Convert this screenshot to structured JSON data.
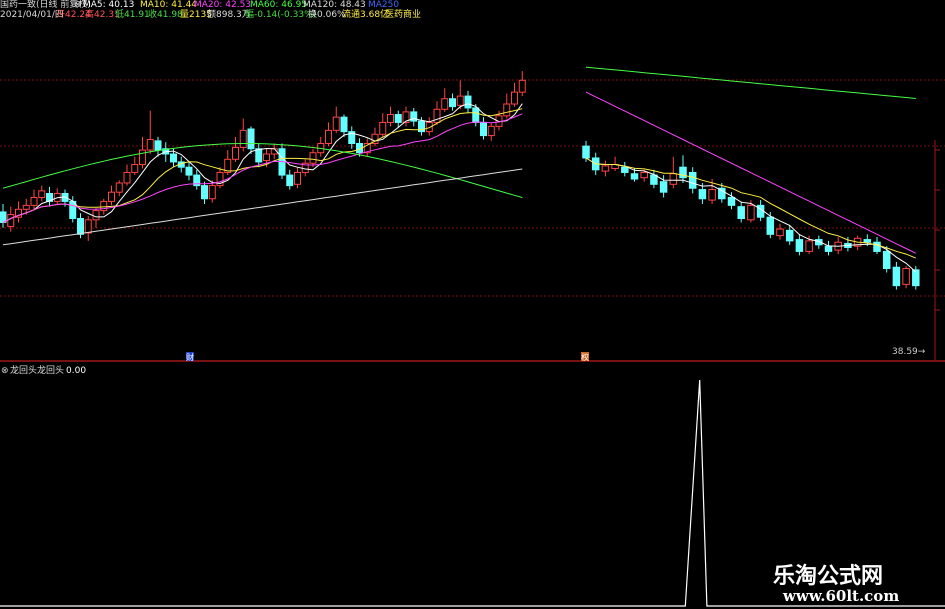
{
  "header": {
    "row1": [
      {
        "text": "国药一致(日线 前复权)",
        "color": "#d8d8d8",
        "left": 0
      },
      {
        "text": "⊗",
        "color": "#d8d8d8",
        "left": 74
      },
      {
        "text": "MA5: 40.13",
        "color": "#ffffff",
        "left": 83
      },
      {
        "text": "MA10: 41.44",
        "color": "#ffee44",
        "left": 140
      },
      {
        "text": "MA20: 42.53",
        "color": "#ff44ff",
        "left": 194
      },
      {
        "text": "MA60: 46.95",
        "color": "#44ff44",
        "left": 250
      },
      {
        "text": "MA120: 48.43",
        "color": "#dddddd",
        "left": 303
      },
      {
        "text": "MA250",
        "color": "#4466ff",
        "left": 368
      }
    ],
    "row2": [
      {
        "text": "2021/04/01/四",
        "color": "#d8d8d8",
        "left": 0
      },
      {
        "text": "开42.24",
        "color": "#ff5555",
        "left": 56
      },
      {
        "text": "高42.31",
        "color": "#ff5555",
        "left": 85
      },
      {
        "text": "低41.91",
        "color": "#44dd44",
        "left": 115
      },
      {
        "text": "收41.98",
        "color": "#44dd44",
        "left": 148
      },
      {
        "text": "量2135",
        "color": "#ffee44",
        "left": 180
      },
      {
        "text": "额898.3万",
        "color": "#dddddd",
        "left": 207
      },
      {
        "text": "幅-0.14(-0.33%)",
        "color": "#44dd44",
        "left": 245
      },
      {
        "text": "换0.06%",
        "color": "#dddddd",
        "left": 308
      },
      {
        "text": "流通3.68亿",
        "color": "#ffee44",
        "left": 342
      },
      {
        "text": "医药商业",
        "color": "#ffee44",
        "left": 385
      }
    ]
  },
  "price_axis": {
    "last_price_label": "38.59→"
  },
  "markers": [
    {
      "text": "财",
      "x": 190
    },
    {
      "text": "权",
      "x": 585
    }
  ],
  "indicator": {
    "title": "龙回头",
    "label": "龙回头",
    "value": "0.00"
  },
  "watermark": {
    "line1": "乐淘公式网",
    "line2": "www.60lt.com"
  },
  "colors": {
    "up": "#ff4444",
    "down": "#66ffff",
    "grid": "#7a1010",
    "ma5": "#ffffff",
    "ma10": "#ffee44",
    "ma20": "#ff44ff",
    "ma60": "#44ff44",
    "ma120": "#dddddd"
  },
  "chart_data": [
    {
      "type": "candlestick",
      "columns": [
        "open",
        "close",
        "high",
        "low"
      ],
      "segment_a": [
        [
          44.8,
          44.0,
          45.4,
          43.6
        ],
        [
          43.7,
          44.6,
          45.2,
          43.3
        ],
        [
          44.4,
          45.0,
          45.6,
          44.0
        ],
        [
          45.0,
          45.3,
          45.8,
          44.6
        ],
        [
          45.3,
          45.9,
          46.5,
          45.0
        ],
        [
          45.9,
          46.4,
          46.8,
          45.6
        ],
        [
          46.2,
          45.6,
          46.7,
          45.2
        ],
        [
          45.6,
          46.2,
          46.6,
          45.3
        ],
        [
          46.2,
          45.6,
          46.5,
          45.2
        ],
        [
          45.6,
          44.3,
          46.0,
          44.0
        ],
        [
          44.3,
          43.1,
          44.7,
          42.8
        ],
        [
          43.2,
          44.2,
          44.5,
          42.6
        ],
        [
          44.2,
          44.9,
          45.1,
          43.6
        ],
        [
          44.9,
          45.6,
          45.8,
          44.6
        ],
        [
          45.6,
          46.3,
          46.8,
          45.3
        ],
        [
          46.3,
          47.0,
          47.2,
          46.0
        ],
        [
          47.0,
          47.8,
          48.4,
          46.8
        ],
        [
          47.8,
          48.4,
          49.0,
          47.6
        ],
        [
          48.4,
          49.5,
          50.5,
          48.1
        ],
        [
          49.5,
          50.3,
          52.5,
          49.2
        ],
        [
          50.2,
          49.5,
          50.5,
          49.0
        ],
        [
          49.6,
          49.2,
          50.1,
          48.6
        ],
        [
          49.2,
          48.6,
          49.6,
          48.2
        ],
        [
          48.6,
          48.2,
          49.0,
          47.8
        ],
        [
          48.2,
          47.6,
          48.6,
          47.2
        ],
        [
          47.6,
          46.8,
          48.0,
          46.5
        ],
        [
          46.8,
          45.8,
          47.1,
          45.4
        ],
        [
          45.8,
          46.8,
          47.2,
          45.5
        ],
        [
          46.8,
          47.8,
          48.2,
          46.6
        ],
        [
          47.8,
          48.8,
          49.5,
          47.6
        ],
        [
          48.8,
          49.7,
          50.5,
          48.6
        ],
        [
          49.7,
          51.0,
          51.9,
          49.4
        ],
        [
          51.1,
          49.6,
          51.3,
          49.2
        ],
        [
          49.6,
          48.6,
          50.0,
          48.2
        ],
        [
          48.7,
          49.2,
          49.6,
          48.2
        ],
        [
          49.2,
          49.6,
          50.0,
          48.8
        ],
        [
          49.6,
          47.6,
          50.0,
          47.3
        ],
        [
          47.6,
          46.8,
          48.0,
          46.5
        ],
        [
          46.9,
          47.8,
          48.2,
          46.6
        ],
        [
          47.8,
          48.5,
          48.8,
          47.5
        ],
        [
          48.5,
          49.3,
          49.6,
          48.2
        ],
        [
          49.3,
          50.0,
          50.5,
          49.0
        ],
        [
          50.0,
          51.0,
          51.6,
          49.8
        ],
        [
          51.0,
          52.0,
          52.8,
          50.8
        ],
        [
          52.0,
          50.9,
          52.2,
          50.5
        ],
        [
          50.9,
          50.0,
          51.3,
          49.6
        ],
        [
          50.0,
          49.3,
          50.4,
          49.0
        ],
        [
          49.3,
          50.0,
          50.4,
          49.0
        ],
        [
          50.0,
          50.7,
          51.2,
          49.8
        ],
        [
          50.7,
          51.6,
          52.3,
          50.5
        ],
        [
          51.6,
          52.2,
          52.8,
          51.3
        ],
        [
          52.2,
          51.6,
          52.5,
          51.2
        ],
        [
          51.6,
          52.4,
          52.8,
          51.3
        ],
        [
          52.4,
          51.7,
          52.7,
          51.3
        ],
        [
          51.7,
          50.9,
          52.0,
          50.6
        ],
        [
          50.9,
          51.6,
          52.0,
          50.6
        ],
        [
          51.6,
          52.6,
          53.2,
          51.4
        ],
        [
          52.6,
          53.4,
          54.2,
          52.4
        ],
        [
          53.4,
          52.8,
          53.8,
          52.5
        ],
        [
          52.9,
          53.6,
          54.8,
          52.6
        ],
        [
          53.6,
          52.7,
          54.0,
          52.3
        ],
        [
          52.7,
          51.6,
          53.0,
          51.3
        ],
        [
          51.6,
          50.6,
          52.0,
          50.3
        ],
        [
          50.6,
          51.3,
          51.6,
          50.2
        ],
        [
          51.3,
          52.1,
          52.5,
          51.0
        ],
        [
          52.1,
          53.0,
          53.8,
          51.9
        ],
        [
          53.0,
          53.9,
          54.6,
          52.8
        ],
        [
          53.9,
          54.8,
          55.5,
          53.6
        ]
      ],
      "segment_b": [
        [
          49.8,
          48.9,
          50.2,
          48.6
        ],
        [
          48.9,
          48.0,
          49.3,
          47.6
        ],
        [
          47.9,
          48.3,
          48.7,
          47.5
        ],
        [
          48.1,
          48.4,
          49.0,
          47.9
        ],
        [
          48.2,
          47.8,
          48.6,
          47.5
        ],
        [
          47.7,
          47.3,
          48.1,
          47.1
        ],
        [
          47.4,
          47.8,
          48.0,
          47.1
        ],
        [
          47.6,
          46.9,
          48.0,
          46.6
        ],
        [
          47.1,
          46.3,
          47.6,
          45.9
        ],
        [
          46.9,
          47.7,
          49.0,
          46.6
        ],
        [
          48.2,
          47.4,
          49.1,
          47.0
        ],
        [
          47.8,
          46.6,
          48.2,
          46.2
        ],
        [
          46.5,
          45.8,
          47.0,
          45.4
        ],
        [
          45.7,
          46.5,
          47.3,
          45.4
        ],
        [
          46.6,
          45.8,
          47.0,
          45.5
        ],
        [
          45.9,
          45.3,
          46.3,
          45.0
        ],
        [
          45.2,
          44.3,
          45.6,
          44.0
        ],
        [
          44.2,
          45.3,
          45.7,
          44.0
        ],
        [
          45.3,
          44.4,
          45.7,
          44.1
        ],
        [
          44.4,
          43.1,
          44.8,
          42.8
        ],
        [
          43.0,
          43.5,
          43.9,
          42.7
        ],
        [
          43.4,
          42.6,
          43.8,
          42.3
        ],
        [
          42.7,
          41.8,
          43.1,
          41.5
        ],
        [
          41.8,
          42.6,
          43.0,
          41.6
        ],
        [
          42.7,
          42.3,
          43.0,
          42.0
        ],
        [
          42.2,
          41.8,
          42.6,
          41.5
        ],
        [
          41.9,
          42.5,
          42.9,
          41.6
        ],
        [
          42.4,
          42.1,
          42.9,
          41.8
        ],
        [
          42.2,
          42.8,
          43.0,
          41.9
        ],
        [
          42.7,
          42.5,
          43.1,
          42.2
        ],
        [
          42.5,
          41.8,
          42.9,
          41.6
        ],
        [
          41.8,
          40.5,
          42.2,
          40.2
        ],
        [
          40.6,
          39.2,
          41.0,
          38.9
        ],
        [
          39.3,
          40.5,
          40.7,
          39.0
        ],
        [
          40.4,
          39.2,
          40.7,
          38.9
        ]
      ],
      "ylim": [
        33.4,
        60.9
      ]
    },
    {
      "type": "line",
      "name": "龙回头",
      "x": [
        0,
        95,
        96,
        97,
        98,
        131
      ],
      "values": [
        0,
        0,
        0.5,
        1,
        0,
        0
      ],
      "ylim": [
        0,
        1
      ]
    }
  ]
}
